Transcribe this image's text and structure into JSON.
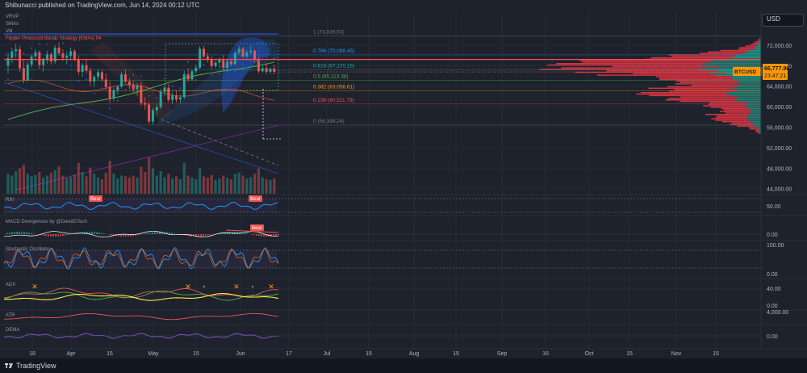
{
  "header": {
    "publisher": "Shibunacci published on TradingView.com, Jun 14, 2024 00:12 UTC"
  },
  "currency_button": "USD",
  "footer": {
    "brand": "TradingView"
  },
  "colors": {
    "bg": "#1e222d",
    "bull": "#26a69a",
    "bear": "#ef5350",
    "fib_green": "#26a69a",
    "fib_orange": "#ff9800",
    "fib_red": "#ef5350",
    "price_tag": "#ff9800",
    "rsi": "#2196f3",
    "vp_red": "#f23645",
    "vp_teal": "#22ab94"
  },
  "indicator_legends": [
    "VRVP",
    "SMAs",
    "Vol",
    "Flipper Pinescript Bands Strategy [EMAs] 54",
    "RSI",
    "MACD Divergences by @DavidDTech",
    "Stochastic Oscillator",
    "ADX",
    "ATR",
    "DEMA"
  ],
  "badges": [
    "Bear",
    "Bear",
    "Bear"
  ],
  "symbol_tag": {
    "symbol": "BTCUSD",
    "price": "66,777.96",
    "countdown": "23:47:21"
  },
  "chart_data": {
    "type": "candlestick",
    "symbol": "BTCUSD",
    "xlabels": [
      "18",
      "Apr",
      "15",
      "May",
      "15",
      "Jun",
      "17",
      "Jul",
      "15",
      "Aug",
      "15",
      "Sep",
      "16",
      "Oct",
      "15",
      "Nov",
      "15"
    ],
    "price_axis": [
      "72,000.00",
      "68,000.00",
      "64,000.00",
      "60,000.00",
      "56,000.00",
      "52,000.00",
      "48,000.00",
      "44,000.00"
    ],
    "ylim": [
      43000,
      74500
    ],
    "last_price": 66777.96,
    "fib_levels": [
      {
        "label": "1 (73,828.53)",
        "value": 73828.53,
        "color": "#787b86"
      },
      {
        "label": "0.786 (70,098.45)",
        "value": 70098.45,
        "color": "#2196f3"
      },
      {
        "label": "0.618 (67,170.16)",
        "value": 67170.16,
        "color": "#26a69a"
      },
      {
        "label": "0.5 (65,113.38)",
        "value": 65113.38,
        "color": "#4caf50"
      },
      {
        "label": "0.382 (63,056.61)",
        "value": 63056.61,
        "color": "#ff9800"
      },
      {
        "label": "0.236 (60,511.79)",
        "value": 60511.79,
        "color": "#ef5350"
      },
      {
        "label": "0 (56,398.24)",
        "value": 56398.24,
        "color": "#787b86"
      }
    ],
    "candles": [
      [
        68000,
        70500,
        66500,
        69500
      ],
      [
        69500,
        71500,
        68500,
        70800
      ],
      [
        70800,
        72300,
        69500,
        71200
      ],
      [
        71200,
        71800,
        66800,
        67500
      ],
      [
        67500,
        69200,
        64500,
        65200
      ],
      [
        65200,
        68800,
        64800,
        68200
      ],
      [
        68200,
        70200,
        67600,
        69800
      ],
      [
        69800,
        71200,
        68900,
        70600
      ],
      [
        70600,
        71000,
        67400,
        68100
      ],
      [
        68100,
        69600,
        66800,
        69100
      ],
      [
        69100,
        70900,
        68400,
        70200
      ],
      [
        70200,
        70600,
        68200,
        68800
      ],
      [
        68800,
        72000,
        68400,
        71500
      ],
      [
        71500,
        72600,
        70000,
        70400
      ],
      [
        70400,
        71200,
        68900,
        69500
      ],
      [
        69500,
        70800,
        68200,
        69900
      ],
      [
        69900,
        71500,
        69200,
        70800
      ],
      [
        70800,
        71200,
        68800,
        69200
      ],
      [
        69200,
        69900,
        66200,
        66800
      ],
      [
        66800,
        68500,
        65800,
        68100
      ],
      [
        68100,
        69200,
        66500,
        67000
      ],
      [
        67000,
        67600,
        64100,
        64900
      ],
      [
        64900,
        66200,
        63800,
        65800
      ],
      [
        65800,
        67400,
        65100,
        66700
      ],
      [
        66700,
        67200,
        64800,
        65300
      ],
      [
        65300,
        66500,
        63200,
        63800
      ],
      [
        63800,
        64900,
        60800,
        61600
      ],
      [
        61600,
        63800,
        61000,
        63200
      ],
      [
        63200,
        64200,
        62400,
        63900
      ],
      [
        63900,
        66800,
        63500,
        66300
      ],
      [
        66300,
        67200,
        64600,
        64900
      ],
      [
        64900,
        65600,
        63400,
        64200
      ],
      [
        64200,
        65000,
        62800,
        63400
      ],
      [
        63400,
        64600,
        62200,
        64100
      ],
      [
        64100,
        64800,
        60200,
        60700
      ],
      [
        60700,
        61900,
        59400,
        60400
      ],
      [
        60400,
        60900,
        56600,
        57100
      ],
      [
        57100,
        59800,
        56500,
        59300
      ],
      [
        59300,
        60500,
        58300,
        59900
      ],
      [
        59900,
        63500,
        59500,
        62900
      ],
      [
        62900,
        64200,
        62000,
        63700
      ],
      [
        63700,
        64400,
        60800,
        61300
      ],
      [
        61300,
        62800,
        60500,
        62200
      ],
      [
        62200,
        63000,
        60800,
        61400
      ],
      [
        61400,
        62400,
        60700,
        61800
      ],
      [
        61800,
        67000,
        61500,
        66300
      ],
      [
        66300,
        67500,
        64900,
        65300
      ],
      [
        65300,
        67300,
        65000,
        66900
      ],
      [
        66900,
        68200,
        66400,
        67600
      ],
      [
        67600,
        71800,
        67300,
        71300
      ],
      [
        71300,
        71900,
        69400,
        69800
      ],
      [
        69800,
        70500,
        68600,
        69200
      ],
      [
        69200,
        69800,
        67400,
        67900
      ],
      [
        67900,
        68900,
        67500,
        68600
      ],
      [
        68600,
        69600,
        67600,
        69100
      ],
      [
        69100,
        70100,
        67000,
        67600
      ],
      [
        67600,
        69200,
        66800,
        68800
      ],
      [
        68800,
        69400,
        67900,
        68300
      ],
      [
        68300,
        70900,
        68000,
        70500
      ],
      [
        70500,
        71900,
        70200,
        71300
      ],
      [
        71300,
        71700,
        69500,
        69800
      ],
      [
        69800,
        71100,
        69400,
        70600
      ],
      [
        70600,
        71900,
        70200,
        70900
      ],
      [
        70900,
        71200,
        68700,
        69200
      ],
      [
        69200,
        69700,
        66500,
        66900
      ],
      [
        66900,
        67900,
        66600,
        67500
      ],
      [
        67500,
        68500,
        66300,
        66800
      ],
      [
        66800,
        67600,
        66400,
        67400
      ],
      [
        67400,
        68200,
        66300,
        66780
      ]
    ],
    "volumes": [
      0.55,
      0.5,
      0.62,
      0.7,
      0.8,
      0.55,
      0.48,
      0.52,
      0.6,
      0.45,
      0.5,
      0.58,
      0.65,
      0.75,
      0.5,
      0.44,
      0.46,
      0.52,
      0.85,
      0.6,
      0.48,
      0.72,
      0.55,
      0.45,
      0.4,
      0.58,
      0.9,
      0.55,
      0.42,
      0.5,
      0.48,
      0.45,
      0.5,
      0.44,
      0.75,
      0.6,
      1.0,
      0.7,
      0.5,
      0.62,
      0.45,
      0.55,
      0.42,
      0.48,
      0.4,
      0.85,
      0.5,
      0.45,
      0.4,
      0.7,
      0.48,
      0.44,
      0.52,
      0.38,
      0.42,
      0.5,
      0.44,
      0.4,
      0.55,
      0.58,
      0.5,
      0.42,
      0.46,
      0.55,
      0.7,
      0.45,
      0.4,
      0.38,
      0.42
    ],
    "rsi_panel": {
      "labels": [
        "50.00"
      ],
      "levels": [
        70,
        50,
        30
      ]
    },
    "macd_panel": {
      "labels": [
        "0.00"
      ]
    },
    "stoch_panel": {
      "labels": [
        "100.00",
        "0.00"
      ]
    },
    "adx_panel": {
      "labels": [
        "40.00",
        "0.00"
      ]
    },
    "atr_panel": {
      "labels": [
        "4,000.00"
      ]
    },
    "dema_panel": {
      "labels": [
        "0.00"
      ]
    }
  }
}
